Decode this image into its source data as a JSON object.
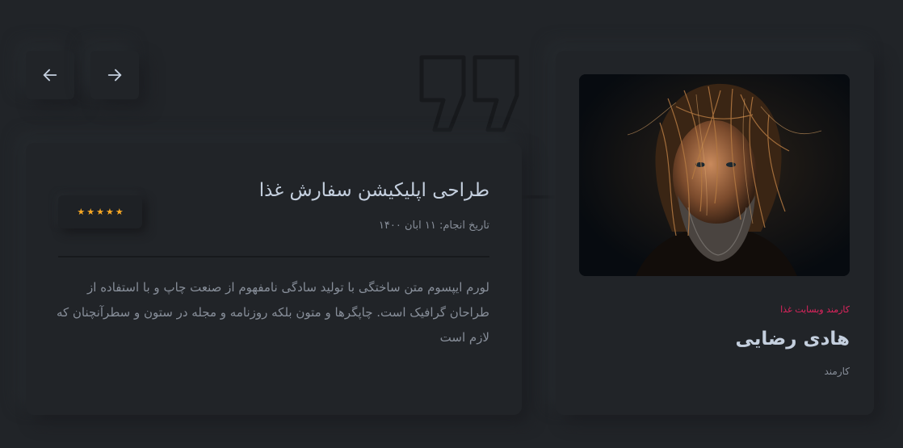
{
  "navigation": {
    "prev_icon": "arrow-left-icon",
    "next_icon": "arrow-right-icon"
  },
  "profile": {
    "photo_icon": "person-photo",
    "role_tag": "کارمند وبسایت غذا",
    "name": "هادی رضایی",
    "title": "کارمند"
  },
  "testimonial": {
    "quote_icon": "quote-icon",
    "project_title": "طراحی اپلیکیشن سفارش غذا",
    "date_text": "تاریخ انجام: ۱۱ ابان ۱۴۰۰",
    "rating": 5,
    "rating_max": 5,
    "description": "لورم ایپسوم متن ساختگی با تولید سادگی نامفهوم از صنعت چاپ و با استفاده از طراحان گرافیک است. چاپگرها و متون بلکه روزنامه و مجله در ستون و سطرآنچنان که لازم است"
  },
  "colors": {
    "background": "#212428",
    "accent": "#e0245e",
    "star": "#f7a825",
    "heading": "#c4cfde",
    "body_text": "#878e99"
  }
}
